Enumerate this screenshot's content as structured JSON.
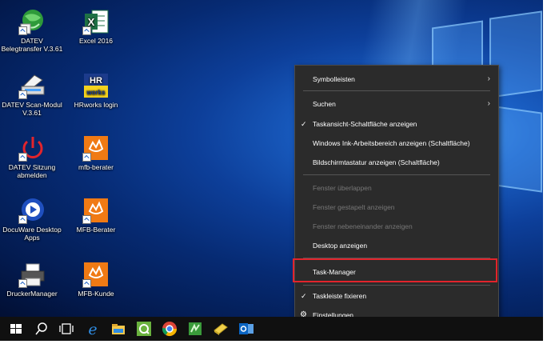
{
  "desktop_icons": [
    {
      "label": "DATEV Belegtransfer V.3.61",
      "icon": "datev-globe-icon"
    },
    {
      "label": "Excel 2016",
      "icon": "excel-icon"
    },
    {
      "label": "DATEV Scan-Modul V.3.61",
      "icon": "scanner-icon"
    },
    {
      "label": "HRworks login",
      "icon": "hrworks-icon"
    },
    {
      "label": "DATEV Sitzung abmelden",
      "icon": "power-icon"
    },
    {
      "label": "mfb-berater",
      "icon": "mfb-icon"
    },
    {
      "label": "DocuWare Desktop Apps",
      "icon": "docuware-icon"
    },
    {
      "label": "MFB-Berater",
      "icon": "mfb-icon"
    },
    {
      "label": "DruckerManager",
      "icon": "printer-icon"
    },
    {
      "label": "MFB-Kunde",
      "icon": "mfb-icon"
    }
  ],
  "excel_logo_letter": "X",
  "hrworks_logo_text": "HR",
  "hrworks_logo_subtext": "works",
  "context_menu": {
    "toolbars": "Symbolleisten",
    "search": "Suchen",
    "task_view": "Taskansicht-Schaltfläche anzeigen",
    "ink_workspace": "Windows Ink-Arbeitsbereich anzeigen (Schaltfläche)",
    "touch_keyboard": "Bildschirmtastatur anzeigen (Schaltfläche)",
    "cascade": "Fenster überlappen",
    "stacked": "Fenster gestapelt anzeigen",
    "side_by_side": "Fenster nebeneinander anzeigen",
    "show_desktop": "Desktop anzeigen",
    "task_manager": "Task-Manager",
    "lock_taskbar": "Taskleiste fixieren",
    "settings": "Einstellungen"
  },
  "taskbar_icons": [
    "windows-start-icon",
    "search-icon",
    "task-view-icon",
    "edge-icon",
    "file-explorer-icon",
    "qlik-icon",
    "chrome-icon",
    "green-app-icon",
    "notes-icon",
    "outlook-icon"
  ],
  "colors": {
    "highlight": "#e2242c",
    "menu_bg": "#2b2b2b",
    "taskbar_bg": "#101010"
  }
}
